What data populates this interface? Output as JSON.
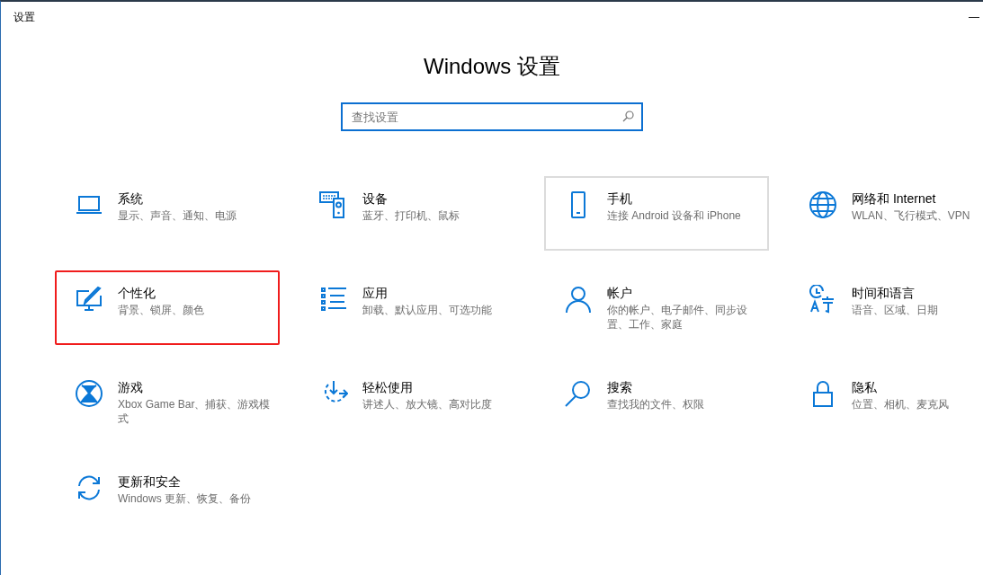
{
  "window": {
    "title": "设置",
    "minimize": "—"
  },
  "heading": "Windows 设置",
  "search": {
    "placeholder": "查找设置"
  },
  "tiles": [
    {
      "title": "系统",
      "desc": "显示、声音、通知、电源",
      "hovered": false,
      "highlighted": false
    },
    {
      "title": "设备",
      "desc": "蓝牙、打印机、鼠标",
      "hovered": false,
      "highlighted": false
    },
    {
      "title": "手机",
      "desc": "连接 Android 设备和 iPhone",
      "hovered": true,
      "highlighted": false
    },
    {
      "title": "网络和 Internet",
      "desc": "WLAN、飞行模式、VPN",
      "hovered": false,
      "highlighted": false
    },
    {
      "title": "个性化",
      "desc": "背景、锁屏、颜色",
      "hovered": false,
      "highlighted": true
    },
    {
      "title": "应用",
      "desc": "卸载、默认应用、可选功能",
      "hovered": false,
      "highlighted": false
    },
    {
      "title": "帐户",
      "desc": "你的帐户、电子邮件、同步设置、工作、家庭",
      "hovered": false,
      "highlighted": false
    },
    {
      "title": "时间和语言",
      "desc": "语音、区域、日期",
      "hovered": false,
      "highlighted": false
    },
    {
      "title": "游戏",
      "desc": "Xbox Game Bar、捕获、游戏模式",
      "hovered": false,
      "highlighted": false
    },
    {
      "title": "轻松使用",
      "desc": "讲述人、放大镜、高对比度",
      "hovered": false,
      "highlighted": false
    },
    {
      "title": "搜索",
      "desc": "查找我的文件、权限",
      "hovered": false,
      "highlighted": false
    },
    {
      "title": "隐私",
      "desc": "位置、相机、麦克风",
      "hovered": false,
      "highlighted": false
    },
    {
      "title": "更新和安全",
      "desc": "Windows 更新、恢复、备份",
      "hovered": false,
      "highlighted": false
    }
  ]
}
